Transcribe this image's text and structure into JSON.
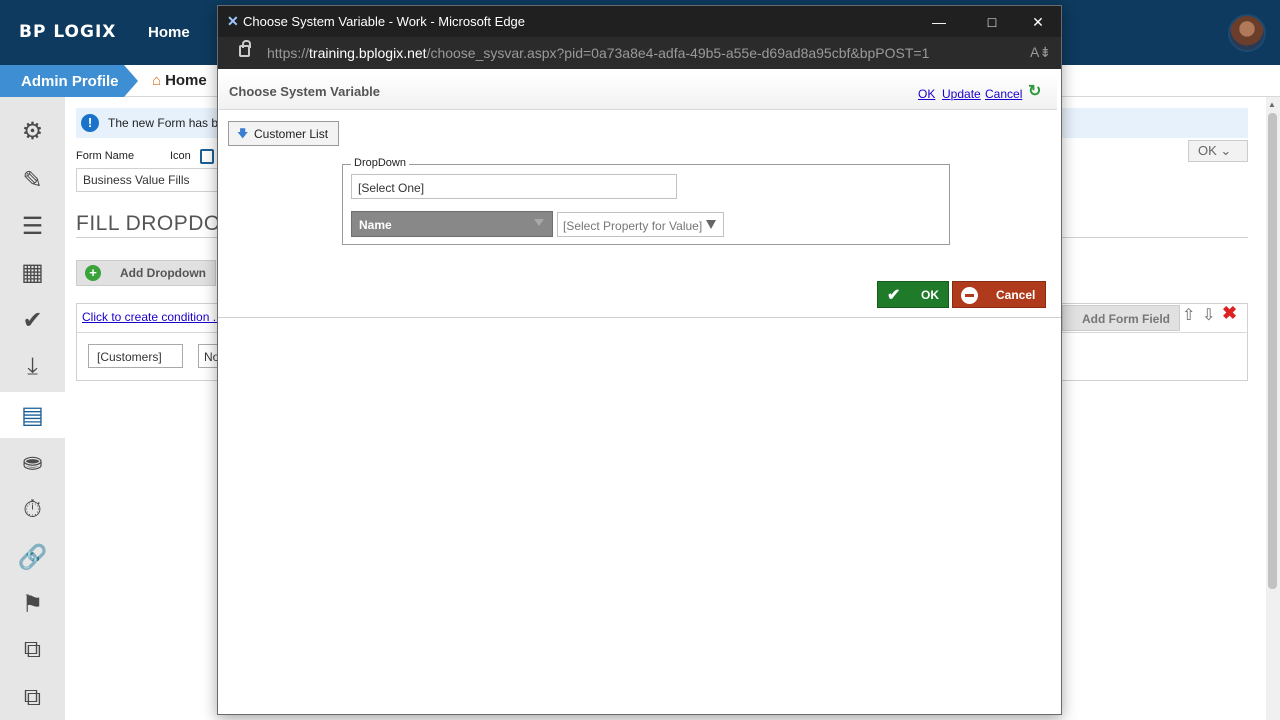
{
  "header": {
    "logo": "BP LOGIX",
    "nav_home": "Home"
  },
  "breadcrumb": {
    "admin": "Admin Profile",
    "home": "Home"
  },
  "sidebar": {
    "items": [
      {
        "name": "settings",
        "icon": "gear-icon"
      },
      {
        "name": "edit",
        "icon": "edit-icon"
      },
      {
        "name": "list",
        "icon": "list-icon"
      },
      {
        "name": "table",
        "icon": "table-icon"
      },
      {
        "name": "check",
        "icon": "check-icon"
      },
      {
        "name": "import",
        "icon": "import-icon"
      },
      {
        "name": "form",
        "icon": "form-icon"
      },
      {
        "name": "database",
        "icon": "database-icon"
      },
      {
        "name": "timer",
        "icon": "timer-icon"
      },
      {
        "name": "link",
        "icon": "link-icon"
      },
      {
        "name": "flag",
        "icon": "flag-icon"
      },
      {
        "name": "workflow",
        "icon": "workflow-icon"
      },
      {
        "name": "copy",
        "icon": "copy-icon"
      }
    ]
  },
  "page": {
    "info_text": "The new Form has b",
    "form_name_label": "Form Name",
    "icon_label": "Icon",
    "form_name_value": "Business Value Fills",
    "heading": "FILL DROPDOW",
    "ok_label": "OK",
    "add_dropdown_label": "Add Dropdown",
    "condition_link": "Click to create condition ..",
    "customers_value": "[Customers]",
    "no_value": "No",
    "add_form_field_label": "Add Form Field"
  },
  "edge": {
    "title": "Choose System Variable - Work - Microsoft Edge",
    "url_scheme": "https://",
    "url_host": "training.bplogix.net",
    "url_path": "/choose_sysvar.aspx?pid=0a73a8e4-adfa-49b5-a55e-d69ad8a95cbf&bpPOST=1"
  },
  "dialog": {
    "title": "Choose System Variable",
    "link_ok": "OK",
    "link_update": "Update",
    "link_cancel": "Cancel",
    "customer_list_label": "Customer List",
    "fieldset_legend": "DropDown",
    "select_one_value": "[Select One]",
    "name_select_value": "Name",
    "property_select_value": "[Select Property for Value]",
    "ok_button": "OK",
    "cancel_button": "Cancel"
  },
  "colors": {
    "topbar": "#0d3a5e",
    "accent_blue": "#3d8ed3",
    "ok_green": "#1f7a2a",
    "cancel_red": "#b03a1c"
  }
}
